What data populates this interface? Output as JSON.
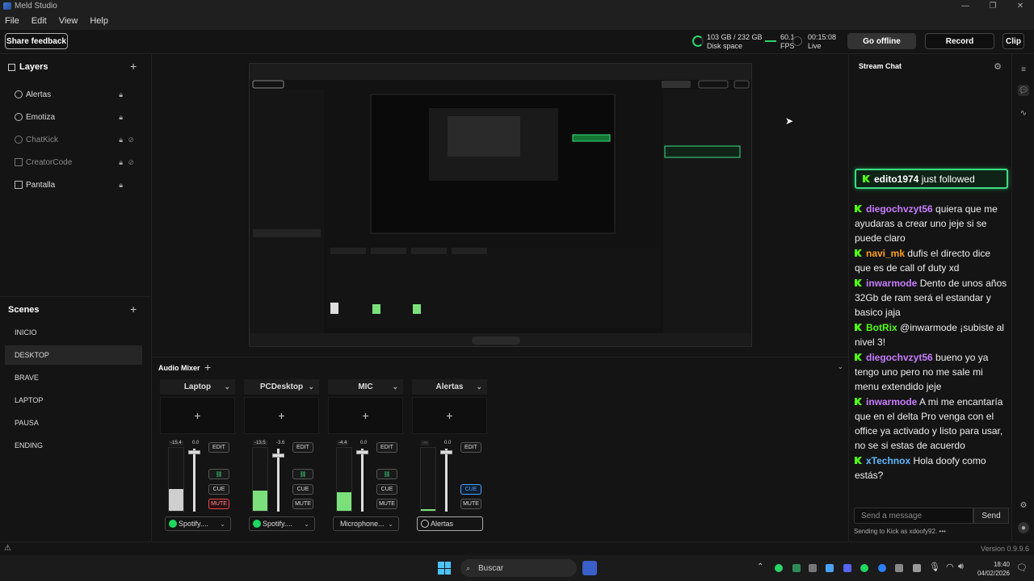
{
  "window": {
    "title": "Meld Studio"
  },
  "menu": [
    "File",
    "Edit",
    "View",
    "Help"
  ],
  "toolbar": {
    "feedback": "Share feedback",
    "disk_value": "103 GB / 232 GB",
    "disk_label": "Disk space",
    "fps_value": "60.1",
    "fps_label": "FPS",
    "time_value": "00:15:08",
    "time_label": "Live",
    "go_offline": "Go offline",
    "record": "Record",
    "clip": "Clip"
  },
  "layers": {
    "title": "Layers",
    "items": [
      {
        "label": "Alertas"
      },
      {
        "label": "Emotiza"
      },
      {
        "label": "ChatKick"
      },
      {
        "label": "CreatorCode"
      },
      {
        "label": "Pantalla"
      }
    ]
  },
  "scenes": {
    "title": "Scenes",
    "items": [
      "INICIO",
      "DESKTOP",
      "BRAVE",
      "LAPTOP",
      "PAUSA",
      "ENDING"
    ],
    "active": "DESKTOP"
  },
  "mixer": {
    "title": "Audio Mixer",
    "channels": [
      {
        "name": "Laptop",
        "level": "-15.4",
        "gain": "0.0",
        "source": "Spotify....",
        "cue": "CUE",
        "mute": "MUTE",
        "edit": "EDIT"
      },
      {
        "name": "PCDesktop",
        "level": "-13.5",
        "gain": "-3.6",
        "source": "Spotify....",
        "cue": "CUE",
        "mute": "MUTE",
        "edit": "EDIT"
      },
      {
        "name": "MIC",
        "level": "-4.4",
        "gain": "0.0",
        "source": "Microphone...",
        "cue": "CUE",
        "mute": "MUTE",
        "edit": "EDIT"
      },
      {
        "name": "Alertas",
        "level": "-∞",
        "gain": "0.0",
        "source": "Alertas",
        "cue": "CUE",
        "mute": "MUTE",
        "edit": "EDIT"
      }
    ]
  },
  "chat": {
    "title": "Stream Chat",
    "banner_user": "edito1974",
    "banner_text": "just followed",
    "messages": [
      {
        "user": "diegochvzyt56",
        "text": "quiera que me ayudaras a crear uno jeje si se puede claro",
        "color": "#c77dff"
      },
      {
        "user": "navi_mk",
        "text": "dufis el directo dice que es de call of duty xd",
        "color": "#ff9f1c"
      },
      {
        "user": "inwarmode",
        "text": "Dento de unos años 32Gb de ram será el estandar y basico jaja",
        "color": "#c77dff"
      },
      {
        "user": "BotRix",
        "text": "@inwarmode ¡subiste al nivel 3!",
        "color": "#53fc18"
      },
      {
        "user": "diegochvzyt56",
        "text": "bueno yo ya tengo uno pero no me sale mi menu extendido jeje",
        "color": "#c77dff"
      },
      {
        "user": "inwarmode",
        "text": "A mi me encantaría que en el delta Pro venga con el office ya activado y listo para usar, no se si estas de acuerdo",
        "color": "#c77dff"
      },
      {
        "user": "xTechnox",
        "text": "Hola doofy como estás?",
        "color": "#5fb8ff"
      }
    ],
    "placeholder": "Send a message",
    "send": "Send",
    "footer": "Sending to Kick as xdoofy92."
  },
  "status": {
    "version": "Version 0.9.9.6"
  },
  "taskbar": {
    "search": "Buscar",
    "time": "18:40",
    "date": "04/02/2026"
  },
  "colors": {
    "accent_green": "#3ddc84",
    "mute_red": "#e5484d",
    "cue_blue": "#4aa3ff"
  }
}
